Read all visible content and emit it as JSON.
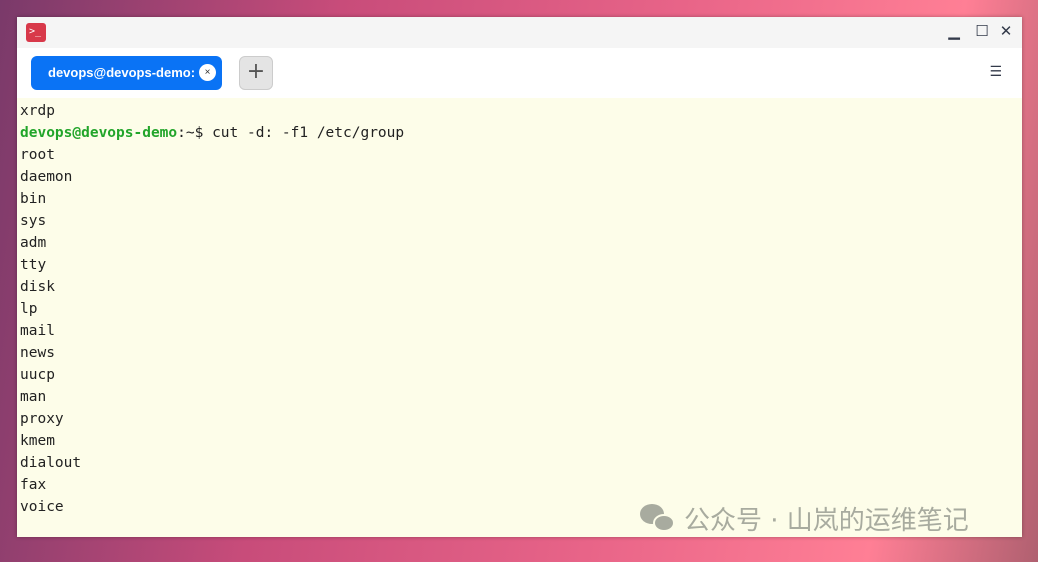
{
  "window": {
    "controls": {
      "minimize": "▁",
      "maximize": "☐",
      "close": "✕"
    },
    "app_icon": ">_"
  },
  "tabs": [
    {
      "label": "devops@devops-demo: ~",
      "close": "×"
    }
  ],
  "new_tab": "+",
  "menu": "☰",
  "terminal": {
    "prev_line": "xrdp",
    "prompt_user": "devops@devops-demo",
    "prompt_path": ":~$ ",
    "command": "cut -d: -f1 /etc/group",
    "output": [
      "root",
      "daemon",
      "bin",
      "sys",
      "adm",
      "tty",
      "disk",
      "lp",
      "mail",
      "news",
      "uucp",
      "man",
      "proxy",
      "kmem",
      "dialout",
      "fax",
      "voice"
    ]
  },
  "watermark": "公众号 · 山岚的运维笔记"
}
